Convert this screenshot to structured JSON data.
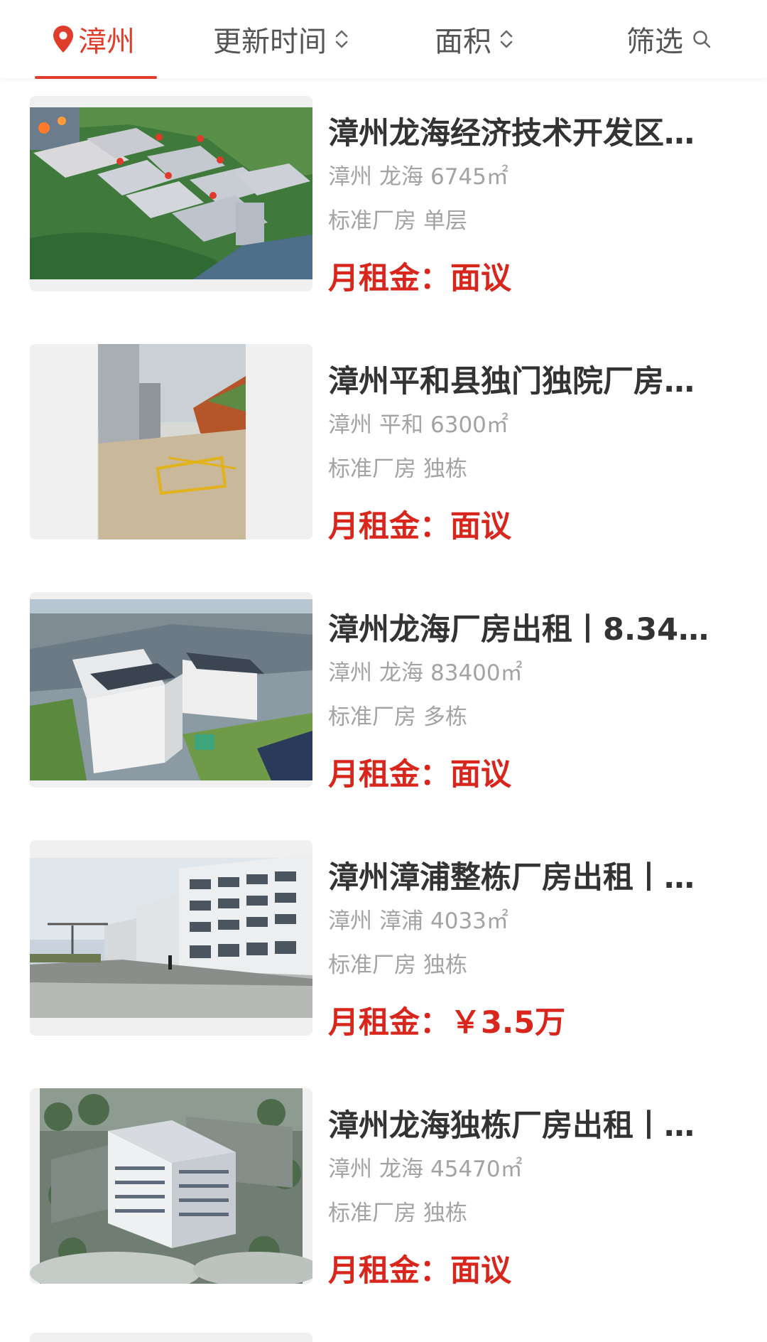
{
  "filter_bar": {
    "city": "漳州",
    "sort_time": "更新时间",
    "sort_area": "面积",
    "filter": "筛选",
    "accent_color": "#e03c2c"
  },
  "listings": [
    {
      "title": "漳州龙海经济技术开发区…",
      "city": "漳州",
      "district": "龙海",
      "area": "6745㎡",
      "type": "标准厂房",
      "subtype": "单层",
      "rent_label": "月租金：",
      "rent_value": "面议",
      "image": "aerial-industrial-park"
    },
    {
      "title": "漳州平和县独门独院厂房…",
      "city": "漳州",
      "district": "平和",
      "area": "6300㎡",
      "type": "标准厂房",
      "subtype": "独栋",
      "rent_label": "月租金：",
      "rent_value": "面议",
      "image": "factory-yard-portrait"
    },
    {
      "title": "漳州龙海厂房出租丨8.34…",
      "city": "漳州",
      "district": "龙海",
      "area": "83400㎡",
      "type": "标准厂房",
      "subtype": "多栋",
      "rent_label": "月租金：",
      "rent_value": "面议",
      "image": "aerial-factory-buildings"
    },
    {
      "title": "漳州漳浦整栋厂房出租丨…",
      "city": "漳州",
      "district": "漳浦",
      "area": "4033㎡",
      "type": "标准厂房",
      "subtype": "独栋",
      "rent_label": "月租金：",
      "rent_value": "￥3.5万",
      "image": "factory-street-view"
    },
    {
      "title": "漳州龙海独栋厂房出租丨…",
      "city": "漳州",
      "district": "龙海",
      "area": "45470㎡",
      "type": "标准厂房",
      "subtype": "独栋",
      "rent_label": "月租金：",
      "rent_value": "面议",
      "image": "rendered-factory-building"
    }
  ]
}
